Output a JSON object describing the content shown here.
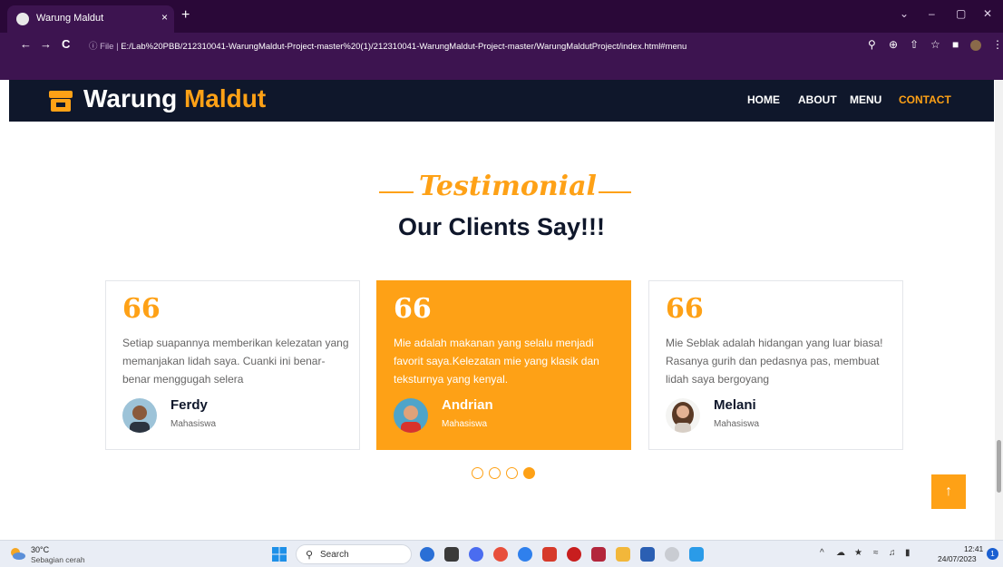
{
  "browser": {
    "tab_title": "Warung Maldut",
    "tab_close": "×",
    "new_tab": "+",
    "url_prefix": "ⓘ File | ",
    "url": "E:/Lab%20PBB/212310041-WarungMaldut-Project-master%20(1)/212310041-WarungMaldut-Project-master/WarungMaldutProject/index.html#menu",
    "back": "←",
    "forward": "→",
    "reload": "C",
    "window_controls": [
      "⌄",
      "–",
      "▢",
      "✕"
    ]
  },
  "navbar": {
    "brand_part1": "Warung",
    "brand_part2": "Maldut",
    "links": [
      "HOME",
      "ABOUT",
      "MENU",
      "CONTACT"
    ],
    "active_link": "CONTACT"
  },
  "testimonial": {
    "subtitle": "Testimonial",
    "title": "Our Clients Say!!!",
    "quote_mark": "66",
    "cards": [
      {
        "text": "Setiap suapannya memberikan kelezatan yang memanjakan lidah saya. Cuanki ini benar-benar menggugah selera",
        "name": "Ferdy",
        "role": "Mahasiswa"
      },
      {
        "text": "Mie adalah makanan yang selalu menjadi favorit saya.Kelezatan mie yang klasik dan teksturnya yang kenyal.",
        "name": "Andrian",
        "role": "Mahasiswa"
      },
      {
        "text": "Mie Seblak adalah hidangan yang luar biasa! Rasanya gurih dan pedasnya pas, membuat lidah saya bergoyang",
        "name": "Melani",
        "role": "Mahasiswa"
      }
    ],
    "carousel_dots": 4,
    "active_dot": 4,
    "active_card": 2
  },
  "back_to_top": "↑",
  "taskbar": {
    "weather_temp": "30°C",
    "weather_cond": "Sebagian cerah",
    "search_label": "Search",
    "time": "12:41",
    "date": "24/07/2023",
    "notification_count": "1"
  },
  "colors": {
    "accent": "#fea116",
    "navbar_bg": "#0f172b",
    "browser_chrome": "#3d1450"
  }
}
